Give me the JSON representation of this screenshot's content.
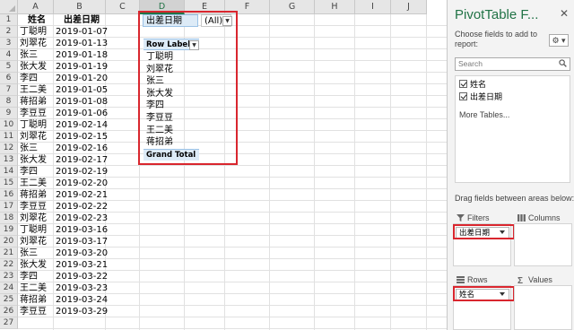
{
  "sheet": {
    "columns": [
      "A",
      "B",
      "C",
      "D",
      "E",
      "F",
      "G",
      "H",
      "I",
      "J"
    ],
    "selected_column": "D",
    "rows": [
      "1",
      "2",
      "3",
      "4",
      "5",
      "6",
      "7",
      "8",
      "9",
      "10",
      "11",
      "12",
      "13",
      "14",
      "15",
      "16",
      "17",
      "18",
      "19",
      "20",
      "21",
      "22",
      "23",
      "24",
      "25",
      "26",
      "27"
    ],
    "headers": {
      "name": "姓名",
      "date": "出差日期"
    },
    "records": [
      {
        "name": "丁聪明",
        "date": "2019-01-07"
      },
      {
        "name": "刘翠花",
        "date": "2019-01-13"
      },
      {
        "name": "张三",
        "date": "2019-01-18"
      },
      {
        "name": "张大发",
        "date": "2019-01-19"
      },
      {
        "name": "李四",
        "date": "2019-01-20"
      },
      {
        "name": "王二美",
        "date": "2019-01-05"
      },
      {
        "name": "蒋招弟",
        "date": "2019-01-08"
      },
      {
        "name": "李豆豆",
        "date": "2019-01-06"
      },
      {
        "name": "丁聪明",
        "date": "2019-02-14"
      },
      {
        "name": "刘翠花",
        "date": "2019-02-15"
      },
      {
        "name": "张三",
        "date": "2019-02-16"
      },
      {
        "name": "张大发",
        "date": "2019-02-17"
      },
      {
        "name": "李四",
        "date": "2019-02-19"
      },
      {
        "name": "王二美",
        "date": "2019-02-20"
      },
      {
        "name": "蒋招弟",
        "date": "2019-02-21"
      },
      {
        "name": "李豆豆",
        "date": "2019-02-22"
      },
      {
        "name": "刘翠花",
        "date": "2019-02-23"
      },
      {
        "name": "丁聪明",
        "date": "2019-03-16"
      },
      {
        "name": "刘翠花",
        "date": "2019-03-17"
      },
      {
        "name": "张三",
        "date": "2019-03-20"
      },
      {
        "name": "张大发",
        "date": "2019-03-21"
      },
      {
        "name": "李四",
        "date": "2019-03-22"
      },
      {
        "name": "王二美",
        "date": "2019-03-23"
      },
      {
        "name": "蒋招弟",
        "date": "2019-03-24"
      },
      {
        "name": "李豆豆",
        "date": "2019-03-29"
      }
    ]
  },
  "pivot": {
    "filter_label": "出差日期",
    "filter_value": "(All)",
    "row_labels_header": "Row Labels",
    "items": [
      "丁聪明",
      "刘翠花",
      "张三",
      "张大发",
      "李四",
      "李豆豆",
      "王二美",
      "蒋招弟"
    ],
    "grand_total": "Grand Total"
  },
  "pane": {
    "title": "PivotTable F...",
    "close": "✕",
    "instructions": "Choose fields to add to report:",
    "search_placeholder": "Search",
    "fields": [
      "姓名",
      "出差日期"
    ],
    "more_tables": "More Tables...",
    "drag_instructions": "Drag fields between areas below:",
    "areas": {
      "filters": {
        "label": "Filters",
        "chip": "出差日期"
      },
      "columns": {
        "label": "Columns"
      },
      "rows": {
        "label": "Rows",
        "chip": "姓名"
      },
      "values": {
        "label": "Values"
      }
    },
    "accent_color": "#217346",
    "highlight_color": "#d9262e"
  }
}
